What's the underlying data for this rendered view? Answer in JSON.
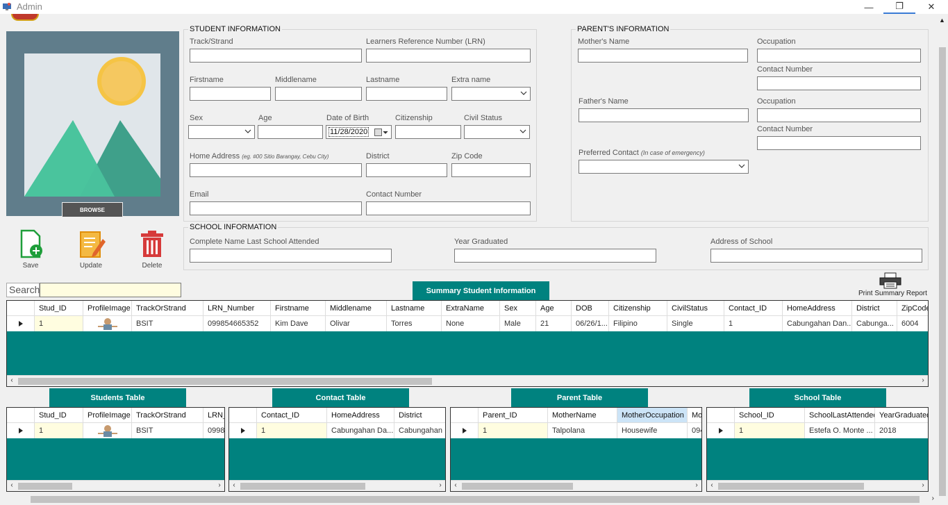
{
  "window": {
    "title": "Admin",
    "minimize": "—",
    "restore": "❐",
    "close": "✕"
  },
  "photo": {
    "browse_label": "BROWSE"
  },
  "actions": {
    "save": "Save",
    "update": "Update",
    "delete": "Delete"
  },
  "student_info": {
    "title": "STUDENT INFORMATION",
    "track_label": "Track/Strand",
    "lrn_label": "Learners Reference Number (LRN)",
    "firstname_label": "Firstname",
    "middlename_label": "Middlename",
    "lastname_label": "Lastname",
    "extraname_label": "Extra name",
    "sex_label": "Sex",
    "age_label": "Age",
    "dob_label": "Date of Birth",
    "dob_value": "11/28/2020",
    "citizenship_label": "Citizenship",
    "civil_status_label": "Civil Status",
    "home_address_label": "Home Address",
    "home_address_hint": "(eg. #00 Sitio Barangay, Cebu City)",
    "district_label": "District",
    "zip_label": "Zip Code",
    "email_label": "Email",
    "contact_label": "Contact Number"
  },
  "parent_info": {
    "title": "PARENT'S INFORMATION",
    "mother_label": "Mother's Name",
    "mother_occupation_label": "Occupation",
    "mother_contact_label": "Contact Number",
    "father_label": "Father's Name",
    "father_occupation_label": "Occupation",
    "father_contact_label": "Contact Number",
    "preferred_label": "Preferred Contact",
    "preferred_hint": "(In case of emergency)"
  },
  "school_info": {
    "title": "SCHOOL INFORMATION",
    "last_school_label": "Complete Name Last School Attended",
    "year_label": "Year Graduated",
    "address_label": "Address of School"
  },
  "search": {
    "label": "Search",
    "value": ""
  },
  "summary": {
    "tab": "Summary Student Information",
    "print_label": "Print Summary Report",
    "columns": [
      "Stud_ID",
      "ProfileImage",
      "TrackOrStrand",
      "LRN_Number",
      "Firstname",
      "Middlename",
      "Lastname",
      "ExtraName",
      "Sex",
      "Age",
      "DOB",
      "Citizenship",
      "CivilStatus",
      "Contact_ID",
      "HomeAddress",
      "District",
      "ZipCode"
    ],
    "row": [
      "1",
      "",
      "BSIT",
      "099854665352",
      "Kim Dave",
      "Olivar",
      "Torres",
      "None",
      "Male",
      "21",
      "06/26/1...",
      "Filipino",
      "Single",
      "1",
      "Cabungahan Dan...",
      "Cabunga...",
      "6004"
    ]
  },
  "students_table": {
    "tab": "Students Table",
    "columns": [
      "Stud_ID",
      "ProfileImage",
      "TrackOrStrand",
      "LRN_"
    ],
    "row": [
      "1",
      "",
      "BSIT",
      "0998"
    ]
  },
  "contact_table": {
    "tab": "Contact Table",
    "columns": [
      "Contact_ID",
      "HomeAddress",
      "District"
    ],
    "row": [
      "1",
      "Cabungahan Da...",
      "Cabungahan"
    ]
  },
  "parent_table": {
    "tab": "Parent Table",
    "columns": [
      "Parent_ID",
      "MotherName",
      "MotherOccupation",
      "Mo"
    ],
    "row": [
      "1",
      "Talpolana",
      "Housewife",
      "094"
    ]
  },
  "school_table": {
    "tab": "School Table",
    "columns": [
      "School_ID",
      "SchoolLastAttended",
      "YearGraduated"
    ],
    "row": [
      "1",
      "Estefa O. Monte ...",
      "2018"
    ]
  }
}
